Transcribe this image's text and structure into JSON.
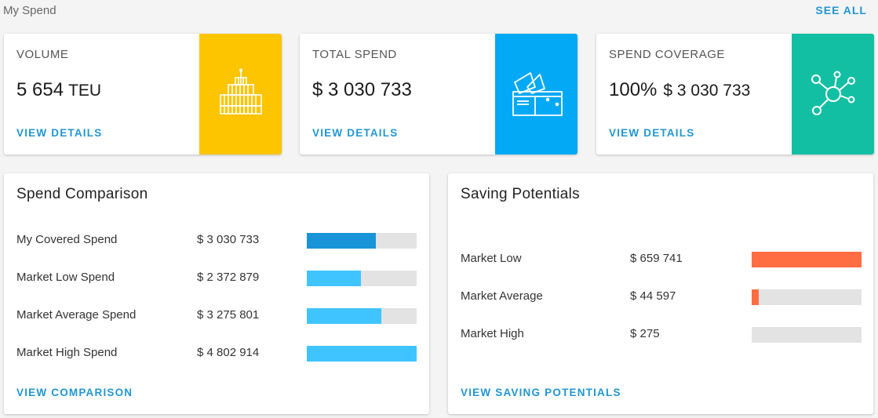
{
  "header": {
    "title": "My Spend",
    "see_all": "SEE ALL"
  },
  "cards": {
    "volume": {
      "label": "VOLUME",
      "value": "5 654",
      "unit": "TEU",
      "link": "VIEW DETAILS",
      "color": "#fdc400",
      "icon": "container-building-icon"
    },
    "total_spend": {
      "label": "TOTAL SPEND",
      "value": "$ 3 030 733",
      "link": "VIEW DETAILS",
      "color": "#03a9f4",
      "icon": "wallet-icon"
    },
    "coverage": {
      "label": "SPEND COVERAGE",
      "percent": "100%",
      "amount": "$ 3 030 733",
      "link": "VIEW DETAILS",
      "color": "#12bfa3",
      "icon": "network-hub-icon"
    }
  },
  "spend_comparison": {
    "title": "Spend Comparison",
    "rows": [
      {
        "label": "My Covered Spend",
        "value": "$ 3 030 733",
        "fill": 0.63,
        "color": "#1a94d9"
      },
      {
        "label": "Market Low Spend",
        "value": "$ 2 372 879",
        "fill": 0.49,
        "color": "#40c4ff"
      },
      {
        "label": "Market Average Spend",
        "value": "$ 3 275 801",
        "fill": 0.68,
        "color": "#40c4ff"
      },
      {
        "label": "Market High Spend",
        "value": "$ 4 802 914",
        "fill": 1.0,
        "color": "#40c4ff"
      }
    ],
    "link": "VIEW COMPARISON"
  },
  "saving_potentials": {
    "title": "Saving Potentials",
    "rows": [
      {
        "label": "Market Low",
        "value": "$ 659 741",
        "fill": 1.0,
        "color": "#ff6d42"
      },
      {
        "label": "Market Average",
        "value": "$ 44 597",
        "fill": 0.065,
        "color": "#ff6d42"
      },
      {
        "label": "Market High",
        "value": "$ 275",
        "fill": 0.0,
        "color": "#ff6d42"
      }
    ],
    "link": "VIEW SAVING POTENTIALS"
  }
}
